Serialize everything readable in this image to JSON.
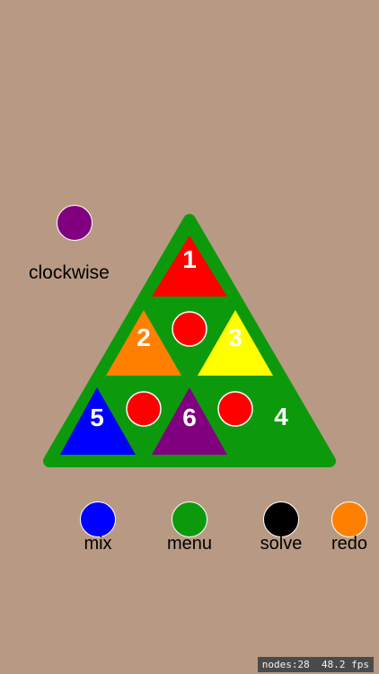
{
  "direction": {
    "label": "clockwise",
    "color": "#800080"
  },
  "board": {
    "frame_color": "#0c9a0c",
    "tiles": [
      {
        "number": "1",
        "color": "#ff0000"
      },
      {
        "number": "2",
        "color": "#ff8000"
      },
      {
        "number": "3",
        "color": "#ffff00"
      },
      {
        "number": "4",
        "color": "#0c9a0c"
      },
      {
        "number": "5",
        "color": "#0000ff"
      },
      {
        "number": "6",
        "color": "#800080"
      }
    ],
    "pivot_color": "#ff0000"
  },
  "controls": [
    {
      "label": "mix",
      "color": "#0000ff"
    },
    {
      "label": "menu",
      "color": "#0c9a0c"
    },
    {
      "label": "solve",
      "color": "#000000"
    },
    {
      "label": "redo",
      "color": "#ff8000"
    }
  ],
  "debug": {
    "nodes": "nodes:28",
    "fps": "48.2 fps"
  }
}
